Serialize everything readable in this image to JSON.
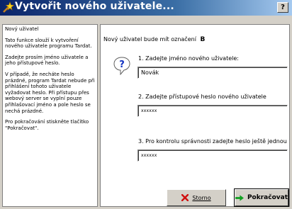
{
  "window": {
    "title": "Vytvořit nového uživatele...",
    "help_label": "?"
  },
  "sidebar": {
    "paragraphs": [
      "Nový uživatel",
      "Tato funkce slouží k vytvoření nového uživatele programu Tardat.",
      "Zadejte prosím jméno uživatele a jeho přístupové heslo.",
      "V případě, že necháte heslo prázdné, program Tardat nebude při přihlášení tohoto uživatele vyžadovat heslo. Při přístupu přes webový server se vyplní pouze přihlašovací jméno a pole heslo se nechá prázdné.",
      "Pro pokračování stiskněte tlačítko \"Pokračovat\"."
    ]
  },
  "main": {
    "intro_label": "Nový uživatel bude mít označení",
    "intro_value": "B",
    "name_prompt": "1. Zadejte jméno nového uživatele:",
    "name_value": "Novák",
    "password_prompt": "2. Zadejte přístupové heslo nového uživatele",
    "password_value": "xxxxxx",
    "confirm_prompt": "3. Pro kontrolu správnosti zadejte heslo ještě jednou",
    "confirm_value": "xxxxxx"
  },
  "buttons": {
    "cancel_label": "Storno",
    "continue_label": "Pokračovat"
  },
  "icons": {
    "title": "wizard-icon",
    "question": "question-icon",
    "cancel": "red-x-icon",
    "continue": "green-arrow-icon"
  },
  "colors": {
    "title_start": "#0a246a",
    "title_end": "#a6caf0",
    "face": "#d4d0c8"
  }
}
